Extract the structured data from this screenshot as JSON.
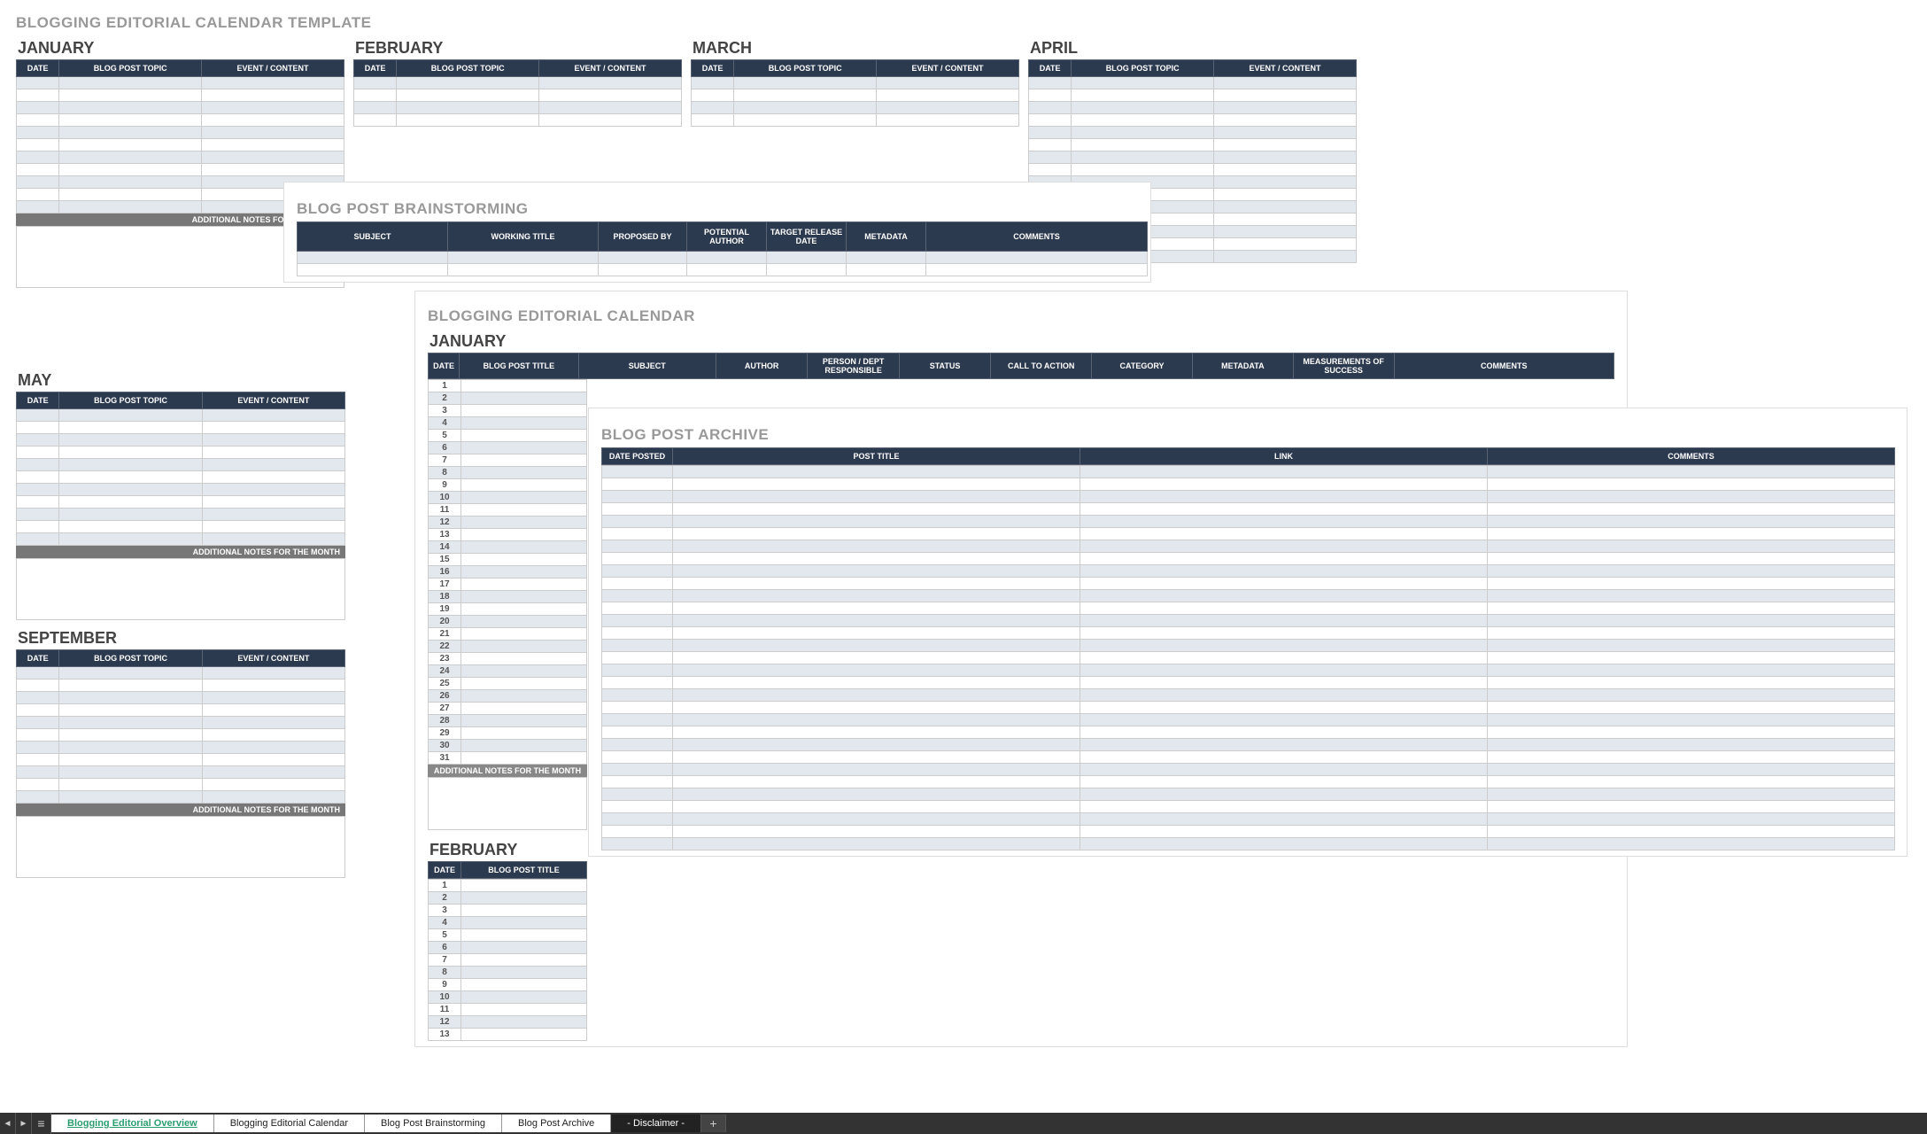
{
  "template": {
    "title": "BLOGGING EDITORIAL CALENDAR TEMPLATE",
    "cols": {
      "date": "DATE",
      "topic": "BLOG POST TOPIC",
      "event": "EVENT / CONTENT"
    },
    "notes_label": "ADDITIONAL NOTES FOR THE MONTH",
    "months_row1": [
      "JANUARY",
      "FEBRUARY",
      "MARCH",
      "APRIL"
    ],
    "months_row2": [
      "MAY"
    ],
    "months_row3": [
      "SEPTEMBER"
    ]
  },
  "brainstorm": {
    "title": "BLOG POST BRAINSTORMING",
    "cols": {
      "subject": "SUBJECT",
      "working_title": "WORKING TITLE",
      "proposed_by": "PROPOSED BY",
      "potential_author": "POTENTIAL AUTHOR",
      "target_release": "TARGET RELEASE DATE",
      "metadata": "METADATA",
      "comments": "COMMENTS"
    }
  },
  "editorial": {
    "title": "BLOGGING EDITORIAL CALENDAR",
    "month1": "JANUARY",
    "month2": "FEBRUARY",
    "notes_label": "ADDITIONAL NOTES FOR THE MONTH",
    "cols": {
      "date": "DATE",
      "title": "BLOG POST TITLE",
      "subject": "SUBJECT",
      "author": "AUTHOR",
      "person": "PERSON / DEPT RESPONSIBLE",
      "status": "STATUS",
      "cta": "CALL TO ACTION",
      "category": "CATEGORY",
      "metadata": "METADATA",
      "mos": "MEASUREMENTS OF SUCCESS",
      "comments": "COMMENTS"
    }
  },
  "archive": {
    "title": "BLOG POST ARCHIVE",
    "cols": {
      "date_posted": "DATE POSTED",
      "post_title": "POST TITLE",
      "link": "LINK",
      "comments": "COMMENTS"
    }
  },
  "tabs": {
    "overview": "Blogging Editorial Overview",
    "calendar": "Blogging Editorial Calendar",
    "brainstorm": "Blog Post Brainstorming",
    "archive": "Blog Post Archive",
    "disclaimer": "- Disclaimer -"
  }
}
